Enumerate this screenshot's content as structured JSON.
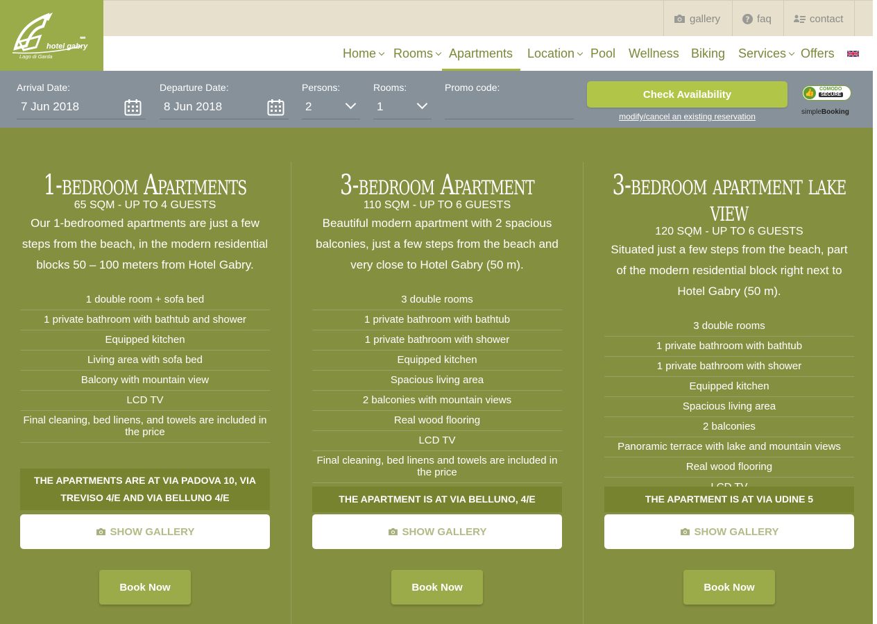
{
  "logo": {
    "name": "hotel gabry",
    "stars": "***",
    "subtitle": "Lago di Garda"
  },
  "topbar": {
    "gallery": "gallery",
    "faq": "faq",
    "contact": "contact"
  },
  "nav": {
    "home": "Home",
    "rooms": "Rooms",
    "apartments": "Apartments",
    "location": "Location",
    "pool": "Pool",
    "wellness": "Wellness",
    "biking": "Biking",
    "services": "Services",
    "offers": "Offers"
  },
  "booking": {
    "arrival_label": "Arrival Date:",
    "arrival_value": "7 Jun 2018",
    "departure_label": "Departure Date:",
    "departure_value": "8 Jun 2018",
    "persons_label": "Persons:",
    "persons_value": "2",
    "rooms_label": "Rooms:",
    "rooms_value": "1",
    "promo_label": "Promo code:",
    "promo_value": "",
    "check_button": "Check Availability",
    "modify_link": "modify/cancel an existing reservation",
    "secure_top": "COMODO",
    "secure_badge": "SECURE",
    "provider_a": "simple",
    "provider_b": "Booking"
  },
  "columns": [
    {
      "title": "1-bedroom Apartments",
      "subtitle": "65 SQM - UP TO 4 GUESTS",
      "description": "Our 1-bedroomed apartments are just a few steps from the beach, in the modern residential blocks 50 – 100 meters from Hotel Gabry.",
      "features": [
        "1 double room + sofa bed",
        "1 private bathroom with bathtub and shower",
        "Equipped kitchen",
        "Living area with sofa bed",
        "Balcony with mountain view",
        "LCD TV",
        "Final cleaning, bed linens, and towels are included in the price"
      ],
      "address": "THE APARTMENTS ARE AT VIA PADOVA 10, VIA TREVISO 4/E AND VIA BELLUNO 4/E",
      "gallery_button": "SHOW GALLERY",
      "book_button": "Book Now"
    },
    {
      "title": "3-bedroom Apartment",
      "subtitle": "110 SQM - UP TO 6 GUESTS",
      "description": "Beautiful modern apartment with 2 spacious balconies, just a few steps from the beach and very close to Hotel Gabry (50 m).",
      "features": [
        "3 double rooms",
        "1 private bathroom with bathtub",
        "1 private bathroom with shower",
        "Equipped kitchen",
        "Spacious living area",
        "2 balconies with mountain views",
        "Real wood flooring",
        "LCD TV",
        "Final cleaning, bed linens and towels are included in the price"
      ],
      "address": "THE APARTMENT IS AT VIA BELLUNO, 4/E",
      "gallery_button": "SHOW GALLERY",
      "book_button": "Book Now"
    },
    {
      "title": "3-bedroom apartment lake view",
      "subtitle": "120 SQM - UP TO 6 GUESTS",
      "description": "Situated just a few steps from the beach, part of the modern residential block right next to Hotel Gabry (50 m).",
      "features": [
        "3 double rooms",
        "1 private bathroom with bathtub",
        "1 private bathroom with shower",
        "Equipped kitchen",
        "Spacious living area",
        "2 balconies",
        "Panoramic terrace with lake and mountain views",
        "Real wood flooring",
        "LCD TV"
      ],
      "address": "THE APARTMENT IS AT VIA UDINE 5",
      "gallery_button": "SHOW GALLERY",
      "book_button": "Book Now"
    }
  ]
}
